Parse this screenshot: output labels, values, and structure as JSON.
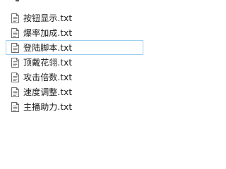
{
  "files": [
    {
      "name": "按钮显示.txt",
      "icon": "text-file-icon",
      "selected": false
    },
    {
      "name": "爆率加成.txt",
      "icon": "text-file-icon",
      "selected": false
    },
    {
      "name": "登陆脚本.txt",
      "icon": "text-file-icon",
      "selected": true
    },
    {
      "name": "顶戴花翎.txt",
      "icon": "text-file-icon",
      "selected": false
    },
    {
      "name": "攻击倍数.txt",
      "icon": "text-file-icon",
      "selected": false
    },
    {
      "name": "速度调整.txt",
      "icon": "text-file-icon",
      "selected": false
    },
    {
      "name": "主播助力.txt",
      "icon": "text-file-icon",
      "selected": false
    }
  ],
  "colors": {
    "selection_border": "#9fd0ef",
    "text": "#1a1a1a",
    "icon_stroke": "#6b6b6b"
  }
}
